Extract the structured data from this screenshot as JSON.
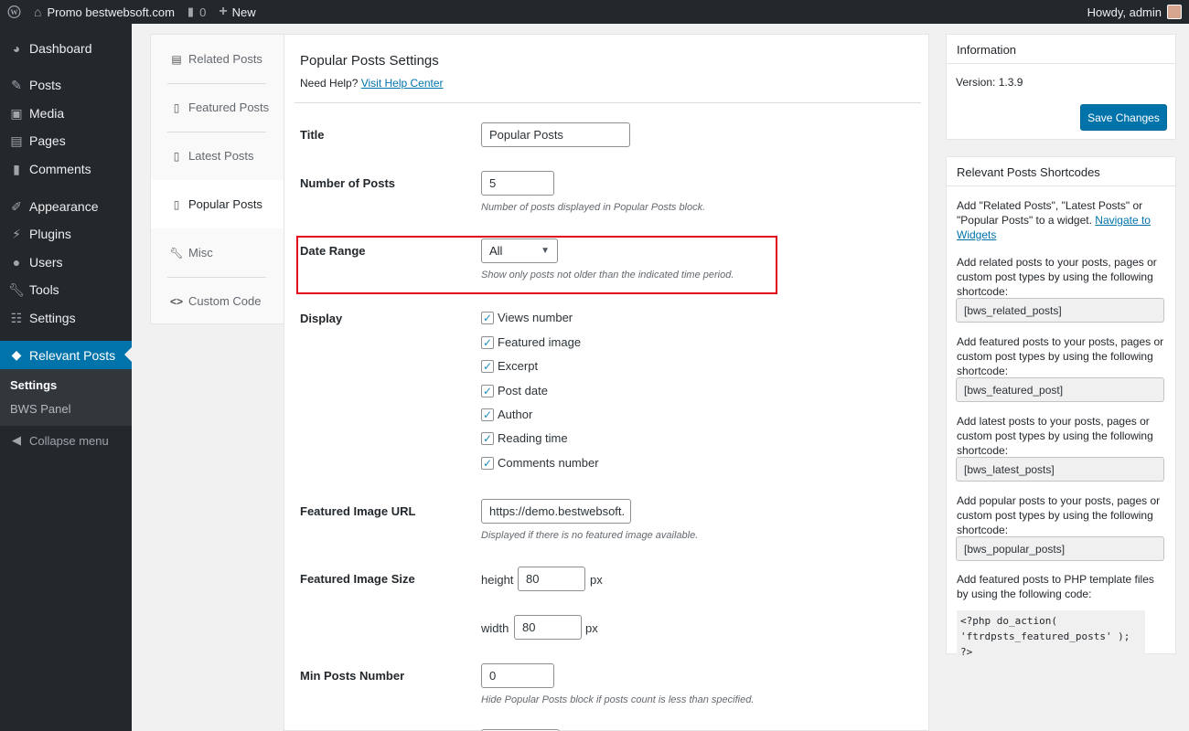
{
  "adminbar": {
    "site_name": "Promo bestwebsoft.com",
    "comments_count": "0",
    "new_label": "New",
    "howdy": "Howdy, admin"
  },
  "sidebar": {
    "items": [
      {
        "label": "Dashboard",
        "icon": "dashboard-icon"
      },
      {
        "label": "Posts",
        "icon": "pin-icon"
      },
      {
        "label": "Media",
        "icon": "media-icon"
      },
      {
        "label": "Pages",
        "icon": "pages-icon"
      },
      {
        "label": "Comments",
        "icon": "comments-icon"
      },
      {
        "label": "Appearance",
        "icon": "brush-icon"
      },
      {
        "label": "Plugins",
        "icon": "plugin-icon"
      },
      {
        "label": "Users",
        "icon": "users-icon"
      },
      {
        "label": "Tools",
        "icon": "wrench-icon"
      },
      {
        "label": "Settings",
        "icon": "settings-icon"
      },
      {
        "label": "Relevant Posts",
        "icon": "bws-icon"
      }
    ],
    "submenu": [
      "Settings",
      "BWS Panel"
    ],
    "collapse": "Collapse menu"
  },
  "tabs": [
    {
      "label": "Related Posts",
      "icon": "document-icon"
    },
    {
      "label": "Featured Posts",
      "icon": "document-icon"
    },
    {
      "label": "Latest Posts",
      "icon": "document-icon"
    },
    {
      "label": "Popular Posts",
      "icon": "document-icon"
    },
    {
      "label": "Misc",
      "icon": "wrench-icon"
    },
    {
      "label": "Custom Code",
      "icon": "code-icon"
    }
  ],
  "main": {
    "title": "Popular Posts Settings",
    "help_prefix": "Need Help?",
    "help_link": "Visit Help Center",
    "title_label": "Title",
    "title_value": "Popular Posts",
    "num_label": "Number of Posts",
    "num_value": "5",
    "num_desc": "Number of posts displayed in Popular Posts block.",
    "date_label": "Date Range",
    "date_value": "All",
    "date_desc": "Show only posts not older than the indicated time period.",
    "display_label": "Display",
    "display_options": [
      {
        "label": "Views number",
        "checked": true
      },
      {
        "label": "Featured image",
        "checked": true
      },
      {
        "label": "Excerpt",
        "checked": true
      },
      {
        "label": "Post date",
        "checked": true
      },
      {
        "label": "Author",
        "checked": true
      },
      {
        "label": "Reading time",
        "checked": true
      },
      {
        "label": "Comments number",
        "checked": true
      }
    ],
    "img_url_label": "Featured Image URL",
    "img_url_value": "https://demo.bestwebsoft.",
    "img_url_desc": "Displayed if there is no featured image available.",
    "img_size_label": "Featured Image Size",
    "height_label": "height",
    "height_value": "80",
    "width_label": "width",
    "width_value": "80",
    "px": "px",
    "min_label": "Min Posts Number",
    "min_value": "0",
    "min_desc": "Hide Popular Posts block if posts count is less than specified."
  },
  "info": {
    "title": "Information",
    "version": "Version: 1.3.9",
    "save": "Save Changes"
  },
  "shortcodes": {
    "title": "Relevant Posts Shortcodes",
    "intro": "Add \"Related Posts\", \"Latest Posts\" or \"Popular Posts\" to a widget.",
    "intro_link": "Navigate to Widgets",
    "related_text": "Add related posts to your posts, pages or custom post types by using the following shortcode:",
    "related_code": "[bws_related_posts]",
    "featured_text": "Add featured posts to your posts, pages or custom post types by using the following shortcode:",
    "featured_code": "[bws_featured_post]",
    "latest_text": "Add latest posts to your posts, pages or custom post types by using the following shortcode:",
    "latest_code": "[bws_latest_posts]",
    "popular_text": "Add popular posts to your posts, pages or custom post types by using the following shortcode:",
    "popular_code": "[bws_popular_posts]",
    "php_text": "Add featured posts to PHP template files by using the following code:",
    "php_code_1": "<?php do_action(",
    "php_code_2": "'ftrdpsts_featured_posts' ); ?>"
  }
}
